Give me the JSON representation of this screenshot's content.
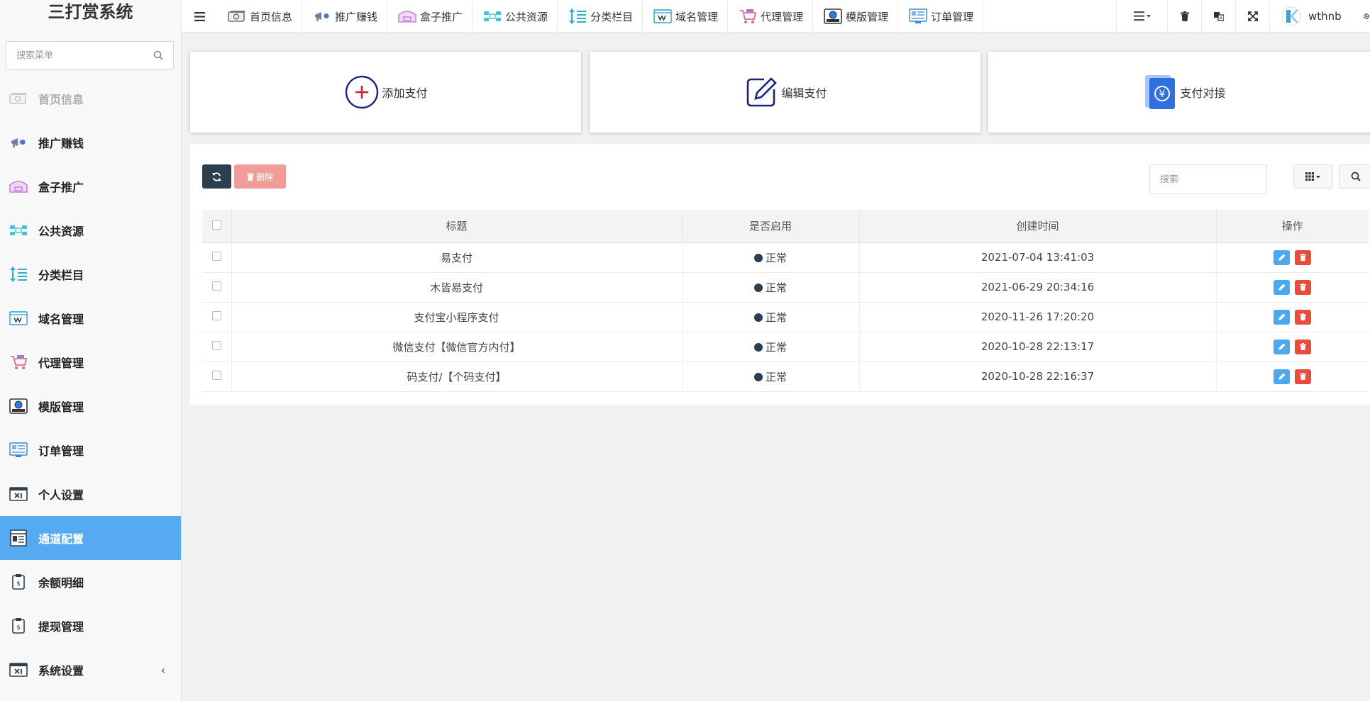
{
  "sidebar": {
    "brand": "三打赏系统",
    "search_placeholder": "搜索菜单",
    "items": [
      {
        "label": "首页信息"
      },
      {
        "label": "推广赚钱"
      },
      {
        "label": "盒子推广"
      },
      {
        "label": "公共资源"
      },
      {
        "label": "分类栏目"
      },
      {
        "label": "域名管理"
      },
      {
        "label": "代理管理"
      },
      {
        "label": "模版管理"
      },
      {
        "label": "订单管理"
      },
      {
        "label": "个人设置"
      },
      {
        "label": "通道配置"
      },
      {
        "label": "余额明细"
      },
      {
        "label": "提现管理"
      },
      {
        "label": "系统设置"
      }
    ],
    "active_item": "通道配置",
    "collapse_glyph": "‹"
  },
  "topnav": {
    "items": [
      {
        "label": "首页信息"
      },
      {
        "label": "推广赚钱"
      },
      {
        "label": "盒子推广"
      },
      {
        "label": "公共资源"
      },
      {
        "label": "分类栏目"
      },
      {
        "label": "域名管理"
      },
      {
        "label": "代理管理"
      },
      {
        "label": "模版管理"
      },
      {
        "label": "订单管理"
      }
    ],
    "username": "wthnb"
  },
  "shortcuts": [
    {
      "label": "添加支付"
    },
    {
      "label": "编辑支付"
    },
    {
      "label": "支付对接"
    }
  ],
  "toolbar": {
    "delete_label": "删除",
    "search_placeholder": "搜索"
  },
  "table": {
    "columns": [
      "标题",
      "是否启用",
      "创建时间",
      "操作"
    ],
    "rows": [
      {
        "title": "易支付",
        "status": "正常",
        "created": "2021-07-04 13:41:03"
      },
      {
        "title": "木皆易支付",
        "status": "正常",
        "created": "2021-06-29 20:34:16"
      },
      {
        "title": "支付宝小程序支付",
        "status": "正常",
        "created": "2020-11-26 17:20:20"
      },
      {
        "title": "微信支付【微信官方内付】",
        "status": "正常",
        "created": "2020-10-28 22:13:17"
      },
      {
        "title": "码支付/【个码支付】",
        "status": "正常",
        "created": "2020-10-28 22:16:37"
      }
    ]
  },
  "colors": {
    "active_menu": "#56aaf1",
    "refresh_button": "#2c3e50",
    "delete_button": "#f19c97",
    "edit_action": "#4da9ef",
    "delete_action": "#e74c3c",
    "status_dot": "#2c3e50"
  }
}
